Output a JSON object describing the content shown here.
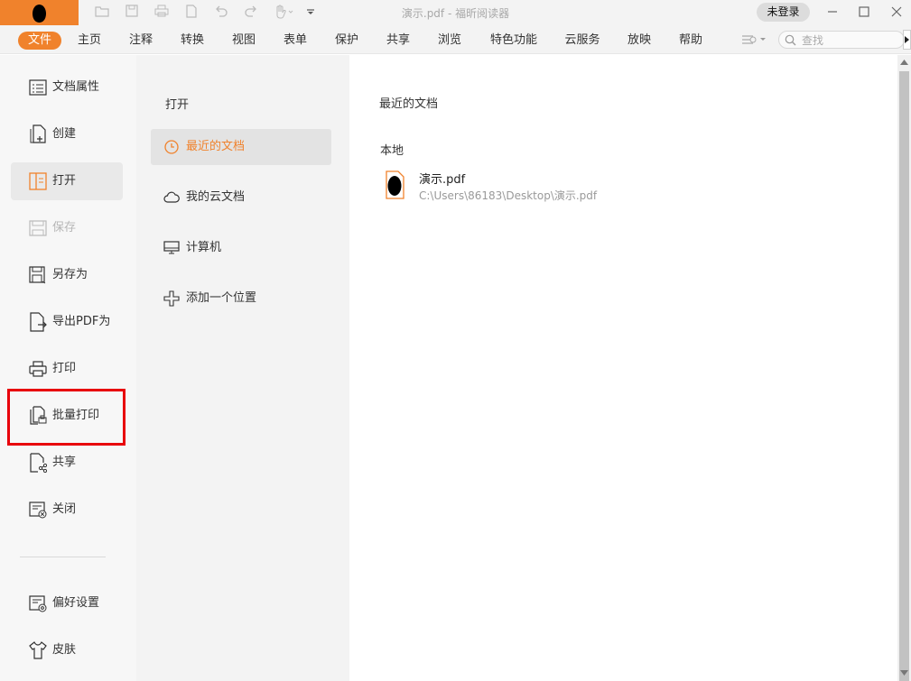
{
  "window": {
    "title": "演示.pdf - 福昕阅读器",
    "login_label": "未登录"
  },
  "menubar": {
    "items": [
      {
        "label": "文件"
      },
      {
        "label": "主页"
      },
      {
        "label": "注释"
      },
      {
        "label": "转换"
      },
      {
        "label": "视图"
      },
      {
        "label": "表单"
      },
      {
        "label": "保护"
      },
      {
        "label": "共享"
      },
      {
        "label": "浏览"
      },
      {
        "label": "特色功能"
      },
      {
        "label": "云服务"
      },
      {
        "label": "放映"
      },
      {
        "label": "帮助"
      }
    ],
    "search_placeholder": "查找"
  },
  "leftnav": {
    "items": [
      {
        "label": "文档属性",
        "icon": "document-properties-icon"
      },
      {
        "label": "创建",
        "icon": "create-icon"
      },
      {
        "label": "打开",
        "icon": "open-icon"
      },
      {
        "label": "保存",
        "icon": "save-icon"
      },
      {
        "label": "另存为",
        "icon": "save-as-icon"
      },
      {
        "label": "导出PDF为",
        "icon": "export-pdf-icon"
      },
      {
        "label": "打印",
        "icon": "print-icon"
      },
      {
        "label": "批量打印",
        "icon": "batch-print-icon"
      },
      {
        "label": "共享",
        "icon": "share-icon"
      },
      {
        "label": "关闭",
        "icon": "close-document-icon"
      },
      {
        "label": "偏好设置",
        "icon": "preferences-icon"
      },
      {
        "label": "皮肤",
        "icon": "skin-icon"
      }
    ]
  },
  "open_panel": {
    "title": "打开",
    "items": [
      {
        "label": "最近的文档",
        "icon": "clock-icon"
      },
      {
        "label": "我的云文档",
        "icon": "cloud-icon"
      },
      {
        "label": "计算机",
        "icon": "computer-icon"
      },
      {
        "label": "添加一个位置",
        "icon": "plus-icon"
      }
    ]
  },
  "main": {
    "title": "最近的文档",
    "section": "本地",
    "files": [
      {
        "name": "演示.pdf",
        "path": "C:\\Users\\86183\\Desktop\\演示.pdf"
      }
    ]
  },
  "colors": {
    "accent": "#f0822c",
    "highlight": "#e8000b"
  }
}
